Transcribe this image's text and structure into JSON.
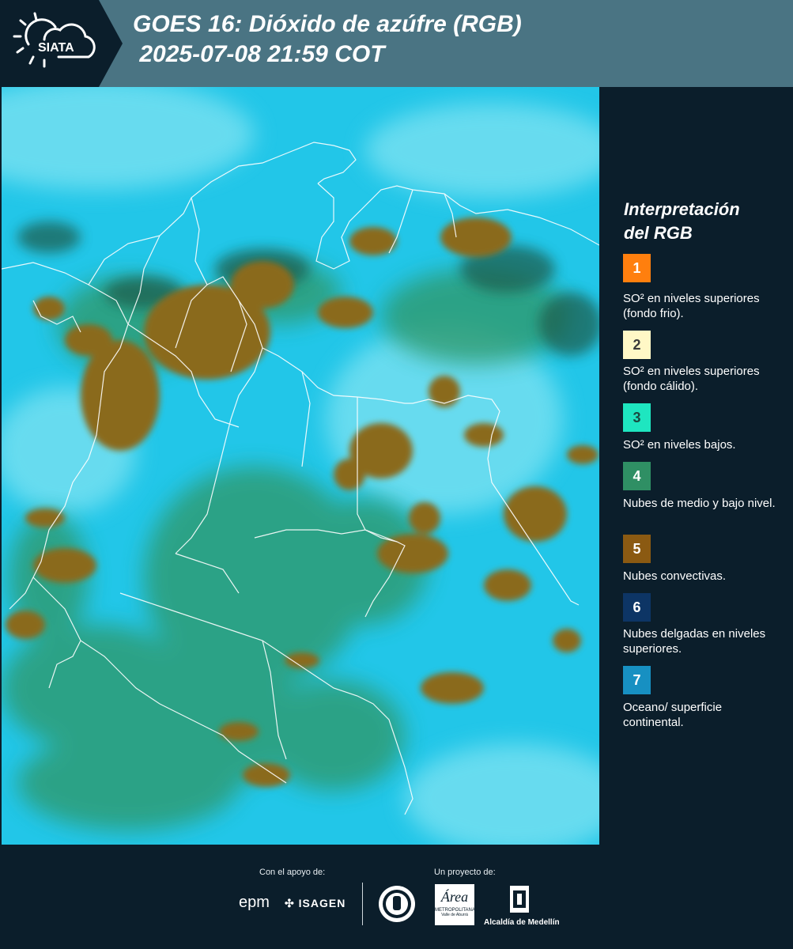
{
  "header": {
    "logo_text": "SIATA",
    "title_line1": "GOES 16: Dióxido de azúfre (RGB)",
    "title_line2": " 2025-07-08 21:59 COT"
  },
  "map": {
    "colors": {
      "background": "#22c6e8",
      "cyan_light": "#7fe3f2",
      "green_cloud": "#2e9a6e",
      "dark_green": "#1a5a48",
      "convective": "#8a6a1e",
      "borders": "#ffffff"
    }
  },
  "legend": {
    "title": "Interpretación\ndel RGB",
    "items": [
      {
        "number": "1",
        "color": "#ff7f0e",
        "text": "SO² en niveles superiores (fondo frio)."
      },
      {
        "number": "2",
        "color": "#fff8c6",
        "text": "SO² en niveles superiores (fondo cálido)."
      },
      {
        "number": "3",
        "color": "#1ee6c0",
        "text": "SO² en niveles bajos."
      },
      {
        "number": "4",
        "color": "#2f8f64",
        "text": "Nubes de medio y bajo nivel."
      },
      {
        "number": "5",
        "color": "#8b5a12",
        "text": "Nubes convectivas."
      },
      {
        "number": "6",
        "color": "#0d3565",
        "text": "Nubes delgadas en niveles superiores."
      },
      {
        "number": "7",
        "color": "#1790c2",
        "text": "Oceano/ superficie continental."
      }
    ]
  },
  "footer": {
    "support_label": "Con el apoyo de:",
    "project_label": "Un proyecto de:",
    "logos": {
      "epm": "epm",
      "isagen": "ISAGEN",
      "area_top": "Área",
      "area_sub": "METROPOLITANA",
      "area_sub2": "Valle de Aburrá",
      "alcaldia": "Alcaldía de Medellín"
    }
  }
}
